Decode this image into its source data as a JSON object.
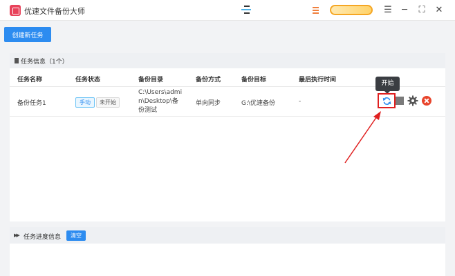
{
  "window": {
    "title": "优速文件备份大师",
    "controls": {
      "menu": "☰",
      "minimize": "─",
      "maximize": "⛶",
      "close": "✕"
    }
  },
  "toolbar": {
    "create_task_label": "创建新任务"
  },
  "task_panel": {
    "title": "任务信息（1个）",
    "columns": [
      "任务名称",
      "任务状态",
      "备份目录",
      "备份方式",
      "备份目标",
      "最后执行时间"
    ],
    "rows": [
      {
        "name": "备份任务1",
        "mode_badge": "手动",
        "status_badge": "未开始",
        "source_dir": "C:\\Users\\admin\\Desktop\\备份测试",
        "method": "单向同步",
        "target": "G:\\优速备份",
        "last_run": "-"
      }
    ],
    "tooltip": "开始"
  },
  "progress_panel": {
    "title": "任务进度信息",
    "clear_label": "清空"
  },
  "colors": {
    "accent": "#2d8cf0",
    "highlight": "#e02020",
    "delete": "#e8452c"
  }
}
